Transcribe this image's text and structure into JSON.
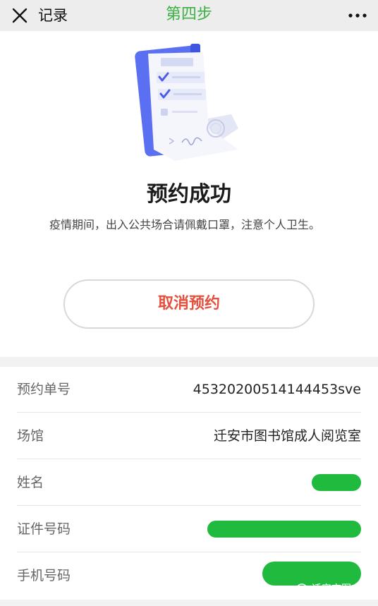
{
  "topbar": {
    "title": "记录",
    "step": "第四步",
    "close_icon": "close-icon",
    "more_icon": "more-icon"
  },
  "result": {
    "title": "预约成功",
    "notice": "疫情期间，出入公共场合请佩戴口罩，注意个人卫生。",
    "cancel_label": "取消预约"
  },
  "details": [
    {
      "label": "预约单号",
      "value": "45320200514144453sve"
    },
    {
      "label": "场馆",
      "value": "迁安市图书馆成人阅览室"
    },
    {
      "label": "姓名",
      "value": ""
    },
    {
      "label": "证件号码",
      "value": ""
    },
    {
      "label": "手机号码",
      "value": ""
    }
  ],
  "watermark": {
    "text": "迁安市图书馆"
  },
  "colors": {
    "step_green": "#3cb043",
    "cancel_red": "#e4503e",
    "illustration_blue": "#5b6ff2",
    "redaction_green": "#1fba3e"
  }
}
